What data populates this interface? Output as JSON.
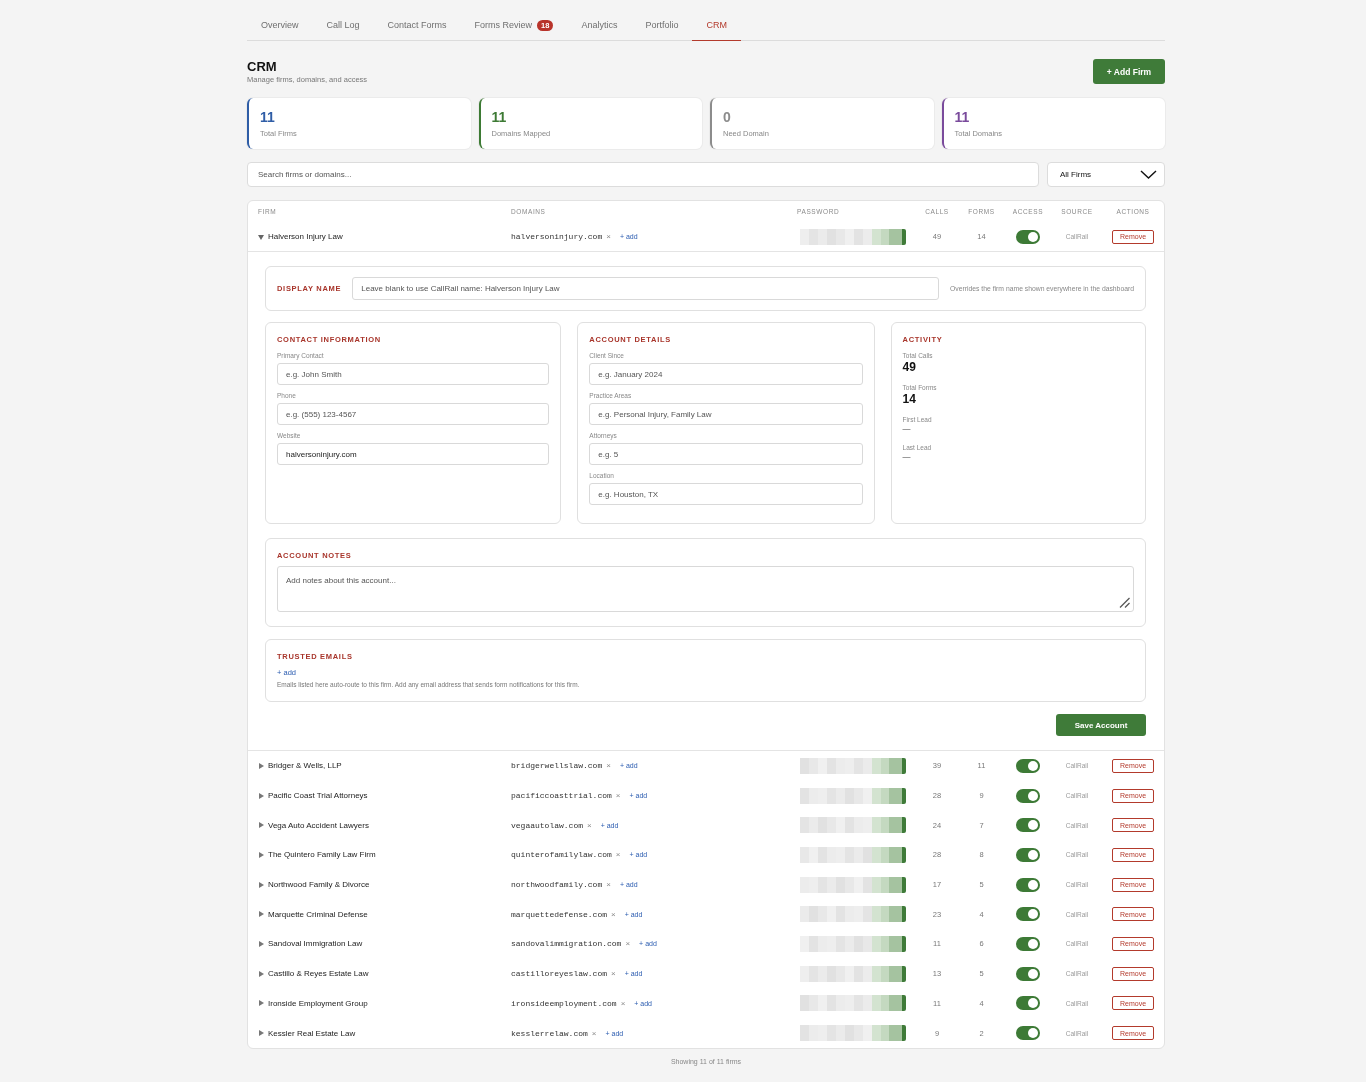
{
  "tabs": [
    {
      "label": "Overview",
      "selected": false
    },
    {
      "label": "Call Log",
      "selected": false
    },
    {
      "label": "Contact Forms",
      "selected": false
    },
    {
      "label": "Forms Review",
      "badge": "18",
      "selected": false
    },
    {
      "label": "Analytics",
      "selected": false
    },
    {
      "label": "Portfolio",
      "selected": false
    },
    {
      "label": "CRM",
      "selected": true
    }
  ],
  "header": {
    "title": "CRM",
    "subtitle": "Manage firms, domains, and access",
    "add_button": "+ Add Firm"
  },
  "stats": [
    {
      "value": "11",
      "label": "Total Firms",
      "color": "#2f5da6"
    },
    {
      "value": "11",
      "label": "Domains Mapped",
      "color": "#3d7a34"
    },
    {
      "value": "0",
      "label": "Need Domain",
      "color": "#8c8c8c"
    },
    {
      "value": "11",
      "label": "Total Domains",
      "color": "#7a4b9c"
    }
  ],
  "filters": {
    "search": {
      "placeholder": "Search firms or domains..."
    },
    "dropdown": {
      "value": "All Firms"
    }
  },
  "table": {
    "columns": [
      "FIRM",
      "DOMAINS",
      "PASSWORD",
      "CALLS",
      "FORMS",
      "ACCESS",
      "SOURCE",
      "ACTIONS"
    ],
    "rows": [
      {
        "firm": "Halverson Injury Law",
        "expanded": true,
        "domains": [
          {
            "name": "halversoninjury.com",
            "remove": "×"
          }
        ],
        "add_link": "+ add",
        "calls": "49",
        "forms": "14",
        "access": true,
        "source": "CallRail",
        "action": "Remove",
        "detail": {
          "display_name": {
            "label": "DISPLAY NAME",
            "placeholder": "Leave blank to use CallRail name: Halverson Injury Law",
            "hint": "Overrides the firm name shown everywhere in the dashboard"
          },
          "sections": [
            {
              "kind": "form",
              "title": "CONTACT INFORMATION",
              "fields": [
                {
                  "label": "Primary Contact",
                  "placeholder": "e.g. John Smith"
                },
                {
                  "label": "Phone",
                  "placeholder": "e.g. (555) 123-4567"
                },
                {
                  "label": "Website",
                  "value": "halversoninjury.com"
                }
              ]
            },
            {
              "kind": "form",
              "title": "ACCOUNT DETAILS",
              "fields": [
                {
                  "label": "Client Since",
                  "placeholder": "e.g. January 2024"
                },
                {
                  "label": "Practice Areas",
                  "placeholder": "e.g. Personal Injury, Family Law"
                },
                {
                  "label": "Attorneys",
                  "placeholder": "e.g. 5"
                },
                {
                  "label": "Location",
                  "placeholder": "e.g. Houston, TX"
                }
              ]
            },
            {
              "kind": "activity",
              "title": "ACTIVITY",
              "items": [
                {
                  "kind": "count",
                  "label": "Total Calls",
                  "value": "49"
                },
                {
                  "kind": "count",
                  "label": "Total Forms",
                  "value": "14"
                },
                {
                  "kind": "date",
                  "label": "First Lead",
                  "value": "—"
                },
                {
                  "kind": "date",
                  "label": "Last Lead",
                  "value": "—"
                }
              ]
            }
          ],
          "notes": {
            "title": "ACCOUNT NOTES",
            "placeholder": "Add notes about this account..."
          },
          "trusted_emails": {
            "title": "TRUSTED EMAILS",
            "add_link": "+ add",
            "help": "Emails listed here auto-route to this firm. Add any email address that sends form notifications for this firm."
          },
          "save_button": "Save Account"
        }
      },
      {
        "firm": "Bridger & Wells, LLP",
        "expanded": false,
        "domains": [
          {
            "name": "bridgerwellslaw.com",
            "remove": "×"
          }
        ],
        "add_link": "+ add",
        "calls": "39",
        "forms": "11",
        "access": true,
        "source": "CallRail",
        "action": "Remove"
      },
      {
        "firm": "Pacific Coast Trial Attorneys",
        "expanded": false,
        "domains": [
          {
            "name": "pacificcoasttrial.com",
            "remove": "×"
          }
        ],
        "add_link": "+ add",
        "calls": "28",
        "forms": "9",
        "access": true,
        "source": "CallRail",
        "action": "Remove"
      },
      {
        "firm": "Vega Auto Accident Lawyers",
        "expanded": false,
        "domains": [
          {
            "name": "vegaautolaw.com",
            "remove": "×"
          }
        ],
        "add_link": "+ add",
        "calls": "24",
        "forms": "7",
        "access": true,
        "source": "CallRail",
        "action": "Remove"
      },
      {
        "firm": "The Quintero Family Law Firm",
        "expanded": false,
        "domains": [
          {
            "name": "quinterofamilylaw.com",
            "remove": "×"
          }
        ],
        "add_link": "+ add",
        "calls": "28",
        "forms": "8",
        "access": true,
        "source": "CallRail",
        "action": "Remove"
      },
      {
        "firm": "Northwood Family & Divorce",
        "expanded": false,
        "domains": [
          {
            "name": "northwoodfamily.com",
            "remove": "×"
          }
        ],
        "add_link": "+ add",
        "calls": "17",
        "forms": "5",
        "access": true,
        "source": "CallRail",
        "action": "Remove"
      },
      {
        "firm": "Marquette Criminal Defense",
        "expanded": false,
        "domains": [
          {
            "name": "marquettedefense.com",
            "remove": "×"
          }
        ],
        "add_link": "+ add",
        "calls": "23",
        "forms": "4",
        "access": true,
        "source": "CallRail",
        "action": "Remove"
      },
      {
        "firm": "Sandoval Immigration Law",
        "expanded": false,
        "domains": [
          {
            "name": "sandovalimmigration.com",
            "remove": "×"
          }
        ],
        "add_link": "+ add",
        "calls": "11",
        "forms": "6",
        "access": true,
        "source": "CallRail",
        "action": "Remove"
      },
      {
        "firm": "Castillo & Reyes Estate Law",
        "expanded": false,
        "domains": [
          {
            "name": "castilloreyeslaw.com",
            "remove": "×"
          }
        ],
        "add_link": "+ add",
        "calls": "13",
        "forms": "5",
        "access": true,
        "source": "CallRail",
        "action": "Remove"
      },
      {
        "firm": "Ironside Employment Group",
        "expanded": false,
        "domains": [
          {
            "name": "ironsideemployment.com",
            "remove": "×"
          }
        ],
        "add_link": "+ add",
        "calls": "11",
        "forms": "4",
        "access": true,
        "source": "CallRail",
        "action": "Remove"
      },
      {
        "firm": "Kessler Real Estate Law",
        "expanded": false,
        "domains": [
          {
            "name": "kesslerrelaw.com",
            "remove": "×"
          }
        ],
        "add_link": "+ add",
        "calls": "9",
        "forms": "2",
        "access": true,
        "source": "CallRail",
        "action": "Remove"
      }
    ],
    "footer": "Showing 11 of 11 firms"
  }
}
